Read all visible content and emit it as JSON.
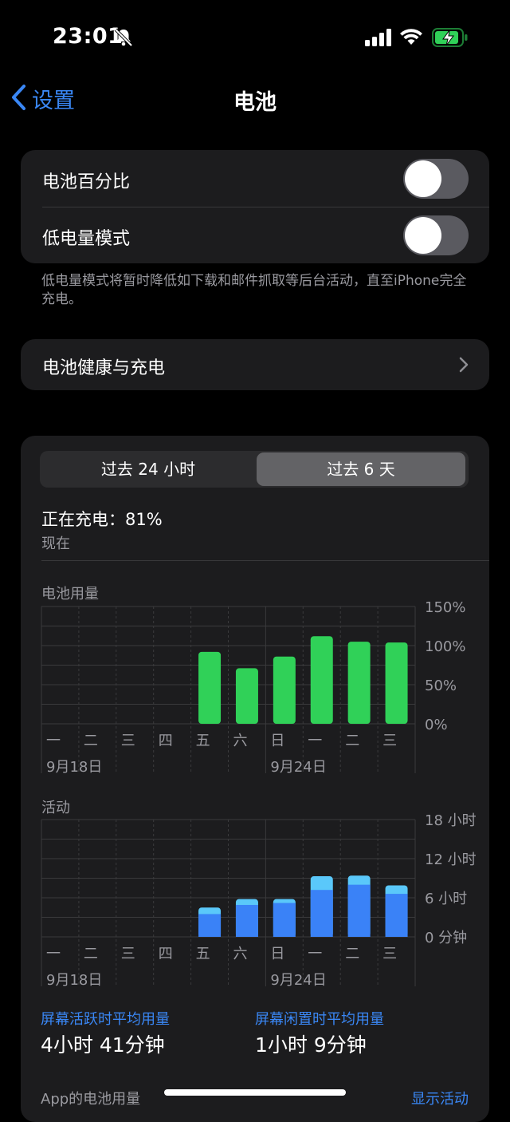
{
  "status": {
    "time": "23:01"
  },
  "nav": {
    "back_label": "设置",
    "title": "电池"
  },
  "settings": {
    "battery_percentage_label": "电池百分比",
    "low_power_label": "低电量模式",
    "low_power_note": "低电量模式将暂时降低如下载和邮件抓取等后台活动，直至iPhone完全充电。",
    "health_label": "电池健康与充电"
  },
  "usage": {
    "tabs": [
      "过去 24 小时",
      "过去 6 天"
    ],
    "selected_tab": 1,
    "charging_status": "正在充电：81%",
    "charging_time": "现在",
    "days": [
      "一",
      "二",
      "三",
      "四",
      "五",
      "六",
      "日",
      "一",
      "二",
      "三"
    ],
    "dates": [
      "9月18日",
      "9月24日"
    ],
    "battery_chart_label": "电池用量",
    "activity_chart_label": "活动",
    "screen_on_title": "屏幕活跃时平均用量",
    "screen_on_value": "4小时 41分钟",
    "screen_off_title": "屏幕闲置时平均用量",
    "screen_off_value": "1小时 9分钟",
    "app_usage_label": "App的电池用量",
    "show_activity_label": "显示活动"
  },
  "chart_data": [
    {
      "type": "bar",
      "title": "电池用量",
      "categories": [
        "一",
        "二",
        "三",
        "四",
        "五",
        "六",
        "日",
        "一",
        "二",
        "三"
      ],
      "values": [
        0,
        0,
        0,
        0,
        92,
        71,
        86,
        112,
        105,
        104
      ],
      "y_ticks": [
        "150%",
        "100%",
        "50%",
        "0%"
      ],
      "ylim": [
        0,
        150
      ],
      "color": "#30d158"
    },
    {
      "type": "bar",
      "title": "活动",
      "categories": [
        "一",
        "二",
        "三",
        "四",
        "五",
        "六",
        "日",
        "一",
        "二",
        "三"
      ],
      "series": [
        {
          "name": "screen_on",
          "values": [
            0,
            0,
            0,
            0,
            3.5,
            4.9,
            5.2,
            7.2,
            8.0,
            6.6
          ],
          "color": "#3a82f7"
        },
        {
          "name": "screen_off",
          "values": [
            0,
            0,
            0,
            0,
            1.0,
            0.9,
            0.6,
            2.1,
            1.4,
            1.3
          ],
          "color": "#5ac8fa"
        }
      ],
      "y_ticks": [
        "18 小时",
        "12 小时",
        "6 小时",
        "0 分钟"
      ],
      "ylim": [
        0,
        18
      ]
    }
  ]
}
